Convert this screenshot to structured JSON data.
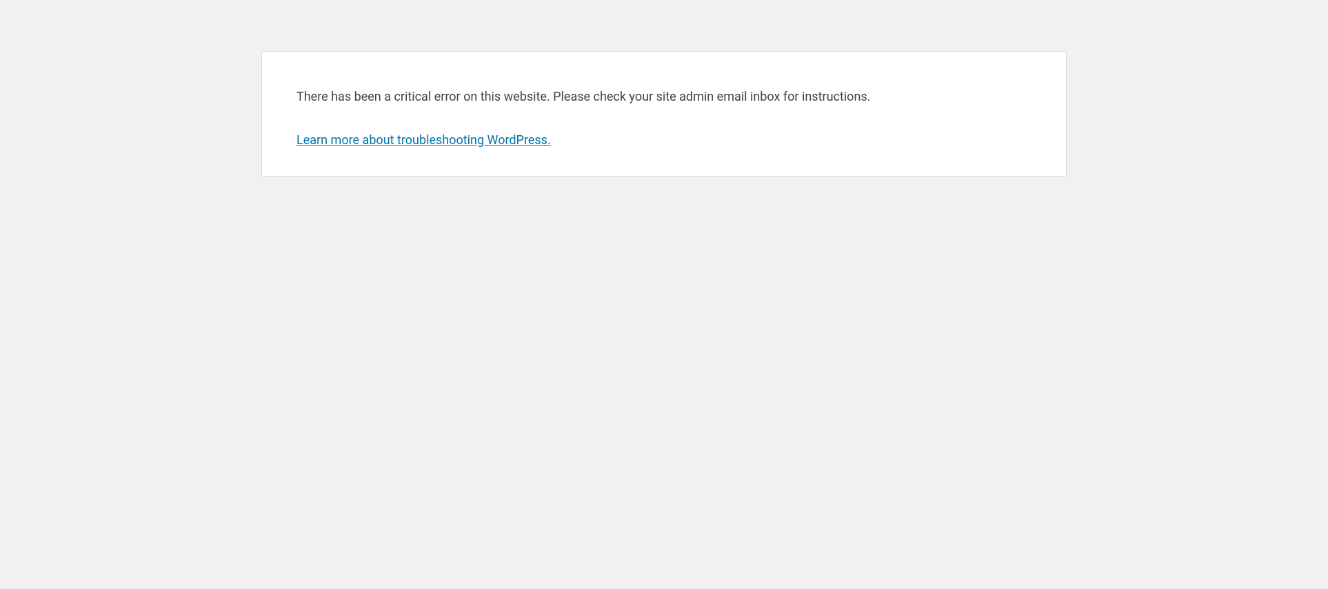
{
  "error": {
    "message": "There has been a critical error on this website. Please check your site admin email inbox for instructions.",
    "link_text": "Learn more about troubleshooting WordPress."
  }
}
